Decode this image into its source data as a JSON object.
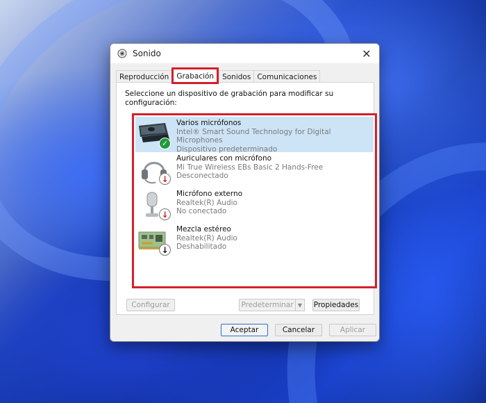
{
  "window": {
    "title": "Sonido",
    "close_glyph": "✕"
  },
  "tabs": [
    {
      "label": "Reproducción"
    },
    {
      "label": "Grabación",
      "active": true
    },
    {
      "label": "Sonidos"
    },
    {
      "label": "Comunicaciones"
    }
  ],
  "instructions": "Seleccione un dispositivo de grabación para modificar su configuración:",
  "devices": [
    {
      "name": "Varios micrófonos",
      "description": "Intel® Smart Sound Technology for Digital Microphones",
      "status": "Dispositivo predeterminado",
      "icon": "microphone-array-icon",
      "badge": "default-check-icon"
    },
    {
      "name": "Auriculares con micrófono",
      "description": "Mi True Wireless EBs Basic 2 Hands-Free",
      "status": "Desconectado",
      "icon": "headset-icon",
      "badge": "disconnected-arrow-icon"
    },
    {
      "name": "Micrófono externo",
      "description": "Realtek(R) Audio",
      "status": "No conectado",
      "icon": "external-microphone-icon",
      "badge": "disconnected-arrow-icon"
    },
    {
      "name": "Mezcla estéreo",
      "description": "Realtek(R) Audio",
      "status": "Deshabilitado",
      "icon": "sound-card-icon",
      "badge": "disabled-arrow-icon"
    }
  ],
  "buttons": {
    "configure": "Configurar",
    "set_default": "Predeterminar",
    "properties": "Propiedades",
    "ok": "Aceptar",
    "cancel": "Cancelar",
    "apply": "Aplicar"
  },
  "colors": {
    "highlight_red": "#d4202a",
    "selection_blue": "#cde4f7",
    "badge_green": "#1f9a3a"
  }
}
